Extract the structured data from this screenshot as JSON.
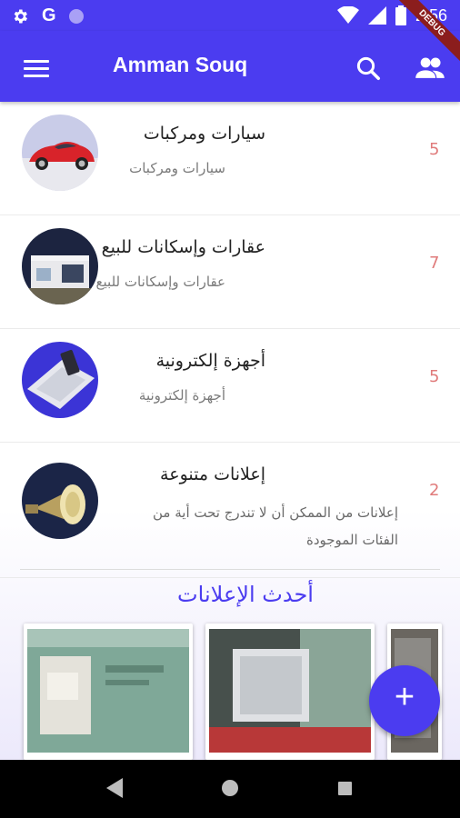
{
  "status_bar": {
    "icons": [
      "gear-icon",
      "google-g-icon",
      "circle-icon",
      "wifi-icon",
      "cellular-signal-icon",
      "battery-icon"
    ],
    "g_letter": "G",
    "time": "2:56",
    "debug_label": "DEBUG"
  },
  "app_bar": {
    "title": "Amman Souq",
    "icons": [
      "menu-icon",
      "search-icon",
      "people-icon"
    ],
    "color": "#4b3cf0"
  },
  "categories": [
    {
      "title": "سيارات ومركبات",
      "subtitle": "سيارات ومركبات",
      "count": "5",
      "icon": "car-thumbnail"
    },
    {
      "title": "عقارات وإسكانات للبيع",
      "subtitle": "عقارات وإسكانات للبيع",
      "count": "7",
      "icon": "house-thumbnail"
    },
    {
      "title": "أجهزة إلكترونية",
      "subtitle": "أجهزة إلكترونية",
      "count": "5",
      "icon": "laptop-thumbnail"
    },
    {
      "title": "إعلانات متنوعة",
      "subtitle": "إعلانات من الممكن أن لا تندرج تحت أية من الفئات الموجودة",
      "count": "2",
      "icon": "megaphone-thumbnail"
    }
  ],
  "latest": {
    "title": "أحدث الإعلانات"
  },
  "fab": {
    "label": "+",
    "icon": "add-icon"
  },
  "nav_bar": {
    "icons": [
      "back-icon",
      "home-icon",
      "recents-icon"
    ]
  },
  "colors": {
    "accent": "#4b3cf0",
    "count": "#e07b7b"
  }
}
